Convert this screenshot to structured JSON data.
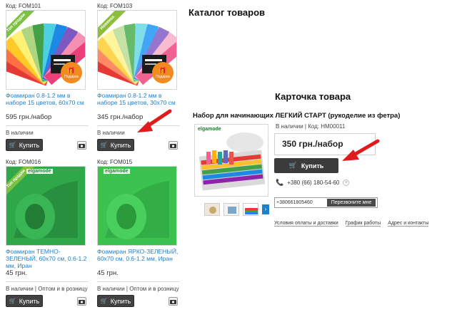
{
  "catalog_heading": "Каталог товаров",
  "card_heading": "Карточка товара",
  "products": [
    {
      "code": "Код: FOM101",
      "name": "Фоамиран 0.8-1.2 мм в наборе 15 цветов, 60x70 см",
      "price": "595 грн./набор",
      "stock": "В наличии",
      "buy": "Купить",
      "badge": "Топ продаж",
      "badge_color": "#7cc142",
      "gift": "Подарок"
    },
    {
      "code": "Код: FOM103",
      "name": "Фоамиран 0.8-1.2 мм в наборе 15 цветов, 30x70 см",
      "price": "345 грн./набор",
      "stock": "В наличии",
      "buy": "Купить",
      "badge": "Новинка",
      "badge_color": "#8dbf3c",
      "gift": "Подарок"
    },
    {
      "code": "Код: FOM016",
      "name": "Фоамиран ТЕМНО-ЗЕЛЕНЫЙ, 60x70 см, 0.6-1.2 мм, Иран",
      "price": "45 грн.",
      "stock": "В наличии | Оптом и в розницу",
      "buy": "Купить",
      "badge": "Топ продаж",
      "badge_color": "#7cc142",
      "brand": "elgamode"
    },
    {
      "code": "Код: FOM015",
      "name": "Фоамиран ЯРКО-ЗЕЛЕНЫЙ, 60x70 см, 0.6-1.2 мм, Иран",
      "price": "45 грн.",
      "stock": "В наличии | Оптом и в розницу",
      "buy": "Купить",
      "brand": "elgamode"
    }
  ],
  "product_card": {
    "title": "Набор для начинающих ЛЕГКИЙ СТАРТ (рукоделие из фетра)",
    "brand": "elgamode",
    "stock": "В наличии | Код: НМ00011",
    "price": "350 грн./набор",
    "buy": "Купить",
    "phone": "+380 (66) 180-54-60",
    "callback_value": "+380661805460",
    "callback_button": "Перезвоните мне",
    "links": [
      "Условия оплаты и доставки",
      "График работы",
      "Адрес и контакты"
    ]
  },
  "colors": {
    "link": "#1f7fc7",
    "button": "#414141",
    "arrow": "#e01b1b",
    "foam_dark_green": "#2fa84a",
    "foam_bright_green": "#3cc24f"
  }
}
